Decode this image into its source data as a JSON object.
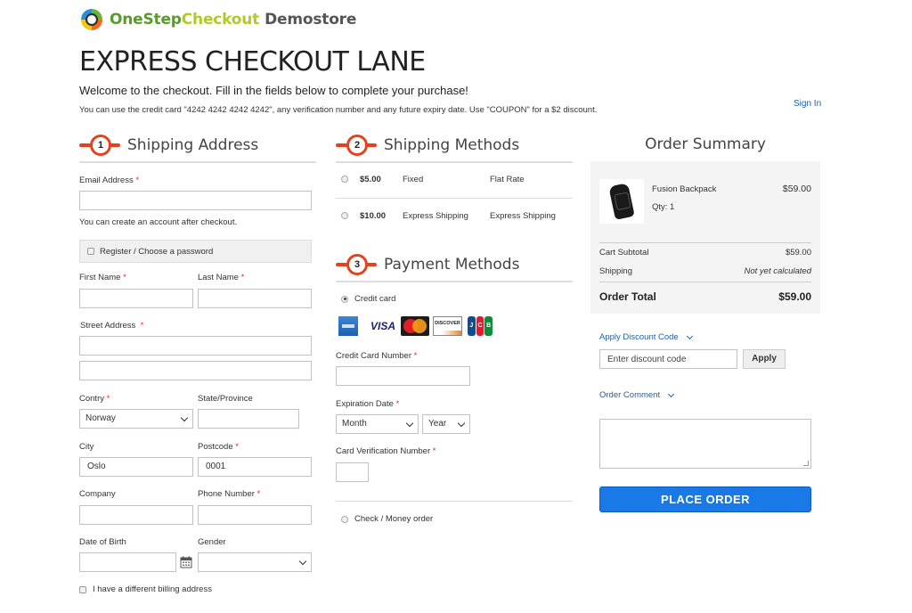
{
  "brand": {
    "name_part1": "OneStep",
    "name_part2": "Checkout",
    "name_part3": "Demostore",
    "colors": {
      "green": "#5a9a2a",
      "lime": "#b5c924",
      "accent": "#e2431c",
      "primary_button": "#1979e6",
      "link": "#1b62a8"
    }
  },
  "page": {
    "title": "EXPRESS CHECKOUT LANE",
    "welcome": "Welcome to the checkout. Fill in the fields below to complete your purchase!",
    "hint": "You can use the credit card \"4242 4242 4242 4242\", any verification number and any future expiry date. Use \"COUPON\" for a $2 discount.",
    "sign_in": "Sign In"
  },
  "shipping_address": {
    "step": "1",
    "title": "Shipping Address",
    "email_label": "Email Address",
    "email_value": "",
    "account_note": "You can create an account after checkout.",
    "register_label": "Register / Choose a password",
    "register_checked": false,
    "first_name_label": "First Name",
    "first_name_value": "",
    "last_name_label": "Last Name",
    "last_name_value": "",
    "street_label": "Street Address",
    "street_line1": "",
    "street_line2": "",
    "country_label": "Contry",
    "country_value": "Norway",
    "state_label": "State/Province",
    "state_value": "",
    "city_label": "City",
    "city_value": "Oslo",
    "postcode_label": "Postcode",
    "postcode_value": "0001",
    "company_label": "Company",
    "company_value": "",
    "phone_label": "Phone Number",
    "phone_value": "",
    "dob_label": "Date of Birth",
    "dob_value": "",
    "gender_label": "Gender",
    "gender_value": "",
    "billing_label": "I have a different billing address",
    "billing_checked": false,
    "required_mark": "*"
  },
  "shipping_methods": {
    "step": "2",
    "title": "Shipping Methods",
    "options": [
      {
        "price": "$5.00",
        "method": "Fixed",
        "carrier": "Flat Rate",
        "selected": false
      },
      {
        "price": "$10.00",
        "method": "Express Shipping",
        "carrier": "Express Shipping",
        "selected": false
      }
    ]
  },
  "payment_methods": {
    "step": "3",
    "title": "Payment Methods",
    "credit_card_label": "Credit card",
    "credit_card_selected": true,
    "card_brands": [
      "amex-icon",
      "visa-icon",
      "mastercard-icon",
      "discover-icon",
      "jcb-icon"
    ],
    "visa_text": "VISA",
    "discover_text": "DISCOVER",
    "jcb_letters": [
      "J",
      "C",
      "B"
    ],
    "cc_number_label": "Credit Card Number",
    "cc_number_value": "",
    "expiration_label": "Expiration Date",
    "month_value": "Month",
    "year_value": "Year",
    "cvv_label": "Card Verification Number",
    "cvv_value": "",
    "check_money_label": "Check / Money order",
    "check_money_selected": false
  },
  "order_summary": {
    "title": "Order Summary",
    "items": [
      {
        "name": "Fusion Backpack",
        "qty": "Qty: 1",
        "price": "$59.00"
      }
    ],
    "subtotal_label": "Cart Subtotal",
    "subtotal_value": "$59.00",
    "shipping_label": "Shipping",
    "shipping_value": "Not yet calculated",
    "total_label": "Order Total",
    "total_value": "$59.00",
    "discount_toggle": "Apply Discount Code",
    "discount_placeholder": "Enter discount code",
    "apply_label": "Apply",
    "comment_toggle": "Order Comment",
    "comment_value": "",
    "place_order_label": "PLACE ORDER"
  }
}
